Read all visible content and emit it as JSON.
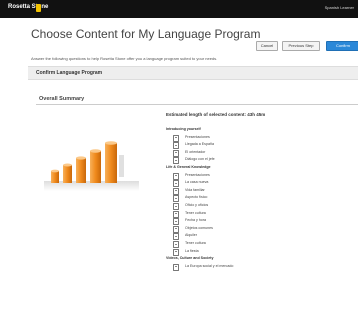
{
  "app": {
    "brand": "Rosetta Stone",
    "top_right": "Spanish Learner"
  },
  "page": {
    "title": "Choose Content for My Language Program",
    "instructions": "Answer the following questions to help Rosetta Stone offer you a language program suited to your needs."
  },
  "buttons": {
    "cancel": "Cancel",
    "previous": "Previous Step",
    "confirm": "Confirm"
  },
  "section": {
    "title": "Confirm Language Program"
  },
  "summary": {
    "title": "Overall Summary",
    "estimated": "Estimated length of selected content: 43h 45m"
  },
  "content_list": [
    {
      "type": "group",
      "label": "Introducing yourself"
    },
    {
      "type": "item",
      "label": "Presentaciones"
    },
    {
      "type": "item",
      "label": "Llegada a España"
    },
    {
      "type": "item",
      "label": "El orientador"
    },
    {
      "type": "item",
      "label": "Diálogo con el jefe"
    },
    {
      "type": "group",
      "label": "Life & General Knowledge"
    },
    {
      "type": "item",
      "label": "Presentaciones"
    },
    {
      "type": "item",
      "label": "La casa nueva"
    },
    {
      "type": "item",
      "label": "Vida familiar"
    },
    {
      "type": "item",
      "label": "Aspecto físico"
    },
    {
      "type": "item",
      "label": "Oficio y oficios"
    },
    {
      "type": "item",
      "label": "Tener cultura"
    },
    {
      "type": "item",
      "label": "Fecha y hora"
    },
    {
      "type": "item",
      "label": "Objetos comunes"
    },
    {
      "type": "item",
      "label": "Alquiler"
    },
    {
      "type": "item",
      "label": "Tener cultura"
    },
    {
      "type": "item",
      "label": "La fiesta"
    },
    {
      "type": "group",
      "label": "Videos, Culture and Society"
    },
    {
      "type": "item",
      "label": "La Europa social y el mercado"
    }
  ],
  "colors": {
    "topbar": "#111111",
    "confirm": "#2b88d8",
    "bars": "#f08a1c"
  },
  "icons": {
    "brand": "rosetta-stone-logo-icon",
    "item": "document-icon"
  }
}
